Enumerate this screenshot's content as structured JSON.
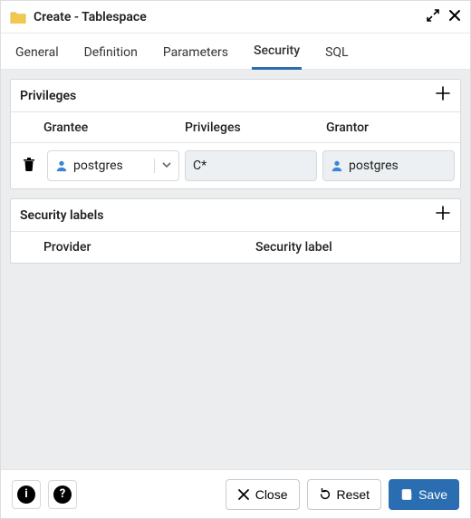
{
  "window": {
    "title": "Create - Tablespace"
  },
  "tabs": {
    "general": "General",
    "definition": "Definition",
    "parameters": "Parameters",
    "security": "Security",
    "sql": "SQL",
    "active": "security"
  },
  "privileges": {
    "title": "Privileges",
    "columns": {
      "grantee": "Grantee",
      "privileges": "Privileges",
      "grantor": "Grantor"
    },
    "rows": [
      {
        "grantee": "postgres",
        "privileges": "C*",
        "grantor": "postgres"
      }
    ]
  },
  "security_labels": {
    "title": "Security labels",
    "columns": {
      "provider": "Provider",
      "security_label": "Security label"
    }
  },
  "footer": {
    "close": "Close",
    "reset": "Reset",
    "save": "Save"
  }
}
